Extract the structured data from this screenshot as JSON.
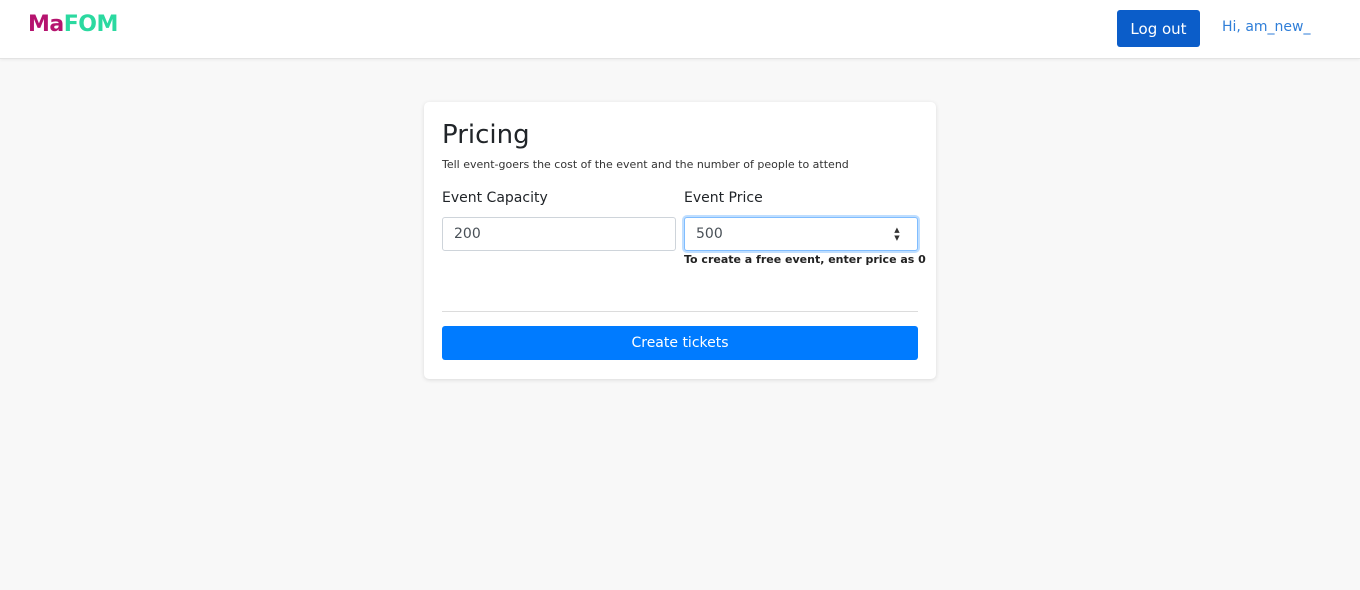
{
  "header": {
    "logo_part1": "Ma",
    "logo_part2": "FOM",
    "logout_label": "Log out",
    "greeting": "Hi, am_new_"
  },
  "pricing": {
    "title": "Pricing",
    "subtitle": "Tell event-goers the cost of the event and the number of people to attend",
    "capacity_label": "Event Capacity",
    "capacity_value": "200",
    "price_label": "Event Price",
    "price_value": "500",
    "price_hint": "To create a free event, enter price as 0",
    "create_label": "Create tickets"
  },
  "icons": {
    "spinner_up": "▲",
    "spinner_down": "▼"
  },
  "colors": {
    "logo_primary": "#b5136e",
    "logo_secondary": "#2bd9a0",
    "logout_bg": "#0b5dc9",
    "greeting": "#2f7ed8",
    "create_bg": "#007bff",
    "focus_border": "#80bdff"
  }
}
